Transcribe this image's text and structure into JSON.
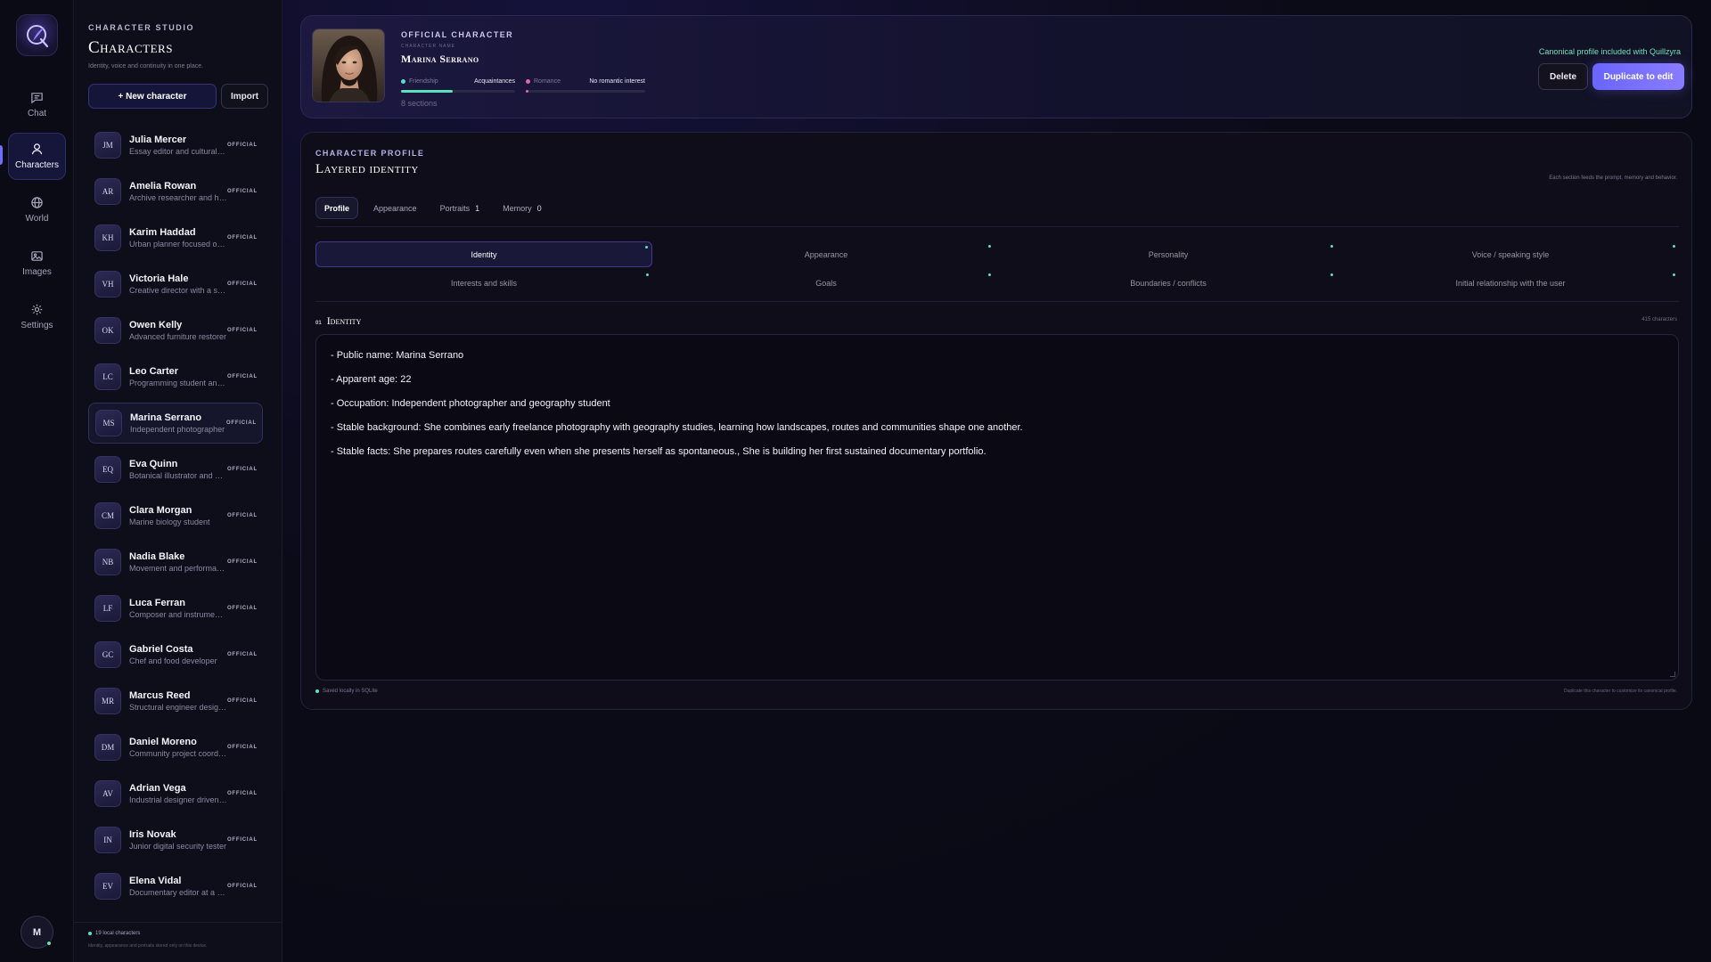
{
  "rail": {
    "items": [
      {
        "label": "Chat",
        "icon": "chat-icon"
      },
      {
        "label": "Characters",
        "icon": "person-icon"
      },
      {
        "label": "World",
        "icon": "globe-icon"
      },
      {
        "label": "Images",
        "icon": "image-icon"
      },
      {
        "label": "Settings",
        "icon": "gear-icon"
      }
    ],
    "avatar_initial": "M"
  },
  "list_panel": {
    "kicker": "CHARACTER STUDIO",
    "title": "Characters",
    "subtitle": "Identity, voice and continuity in one place.",
    "new_button": "+ New character",
    "import_button": "Import",
    "footer_count": "19 local characters",
    "footer_note": "Identity, appearance and portraits stored only on this device."
  },
  "characters": [
    {
      "initials": "JM",
      "name": "Julia Mercer",
      "desc": "Essay editor and cultural writer",
      "badge": "OFFICIAL"
    },
    {
      "initials": "AR",
      "name": "Amelia Rowan",
      "desc": "Archive researcher and historian",
      "badge": "OFFICIAL"
    },
    {
      "initials": "KH",
      "name": "Karim Haddad",
      "desc": "Urban planner focused on cities",
      "badge": "OFFICIAL"
    },
    {
      "initials": "VH",
      "name": "Victoria Hale",
      "desc": "Creative director with a studio",
      "badge": "OFFICIAL"
    },
    {
      "initials": "OK",
      "name": "Owen Kelly",
      "desc": "Advanced furniture restorer",
      "badge": "OFFICIAL"
    },
    {
      "initials": "LC",
      "name": "Leo Carter",
      "desc": "Programming student and tinkerer",
      "badge": "OFFICIAL"
    },
    {
      "initials": "MS",
      "name": "Marina Serrano",
      "desc": "Independent photographer",
      "badge": "OFFICIAL"
    },
    {
      "initials": "EQ",
      "name": "Eva Quinn",
      "desc": "Botanical illustrator and gardener",
      "badge": "OFFICIAL"
    },
    {
      "initials": "CM",
      "name": "Clara Morgan",
      "desc": "Marine biology student",
      "badge": "OFFICIAL"
    },
    {
      "initials": "NB",
      "name": "Nadia Blake",
      "desc": "Movement and performance artist",
      "badge": "OFFICIAL"
    },
    {
      "initials": "LF",
      "name": "Luca Ferran",
      "desc": "Composer and instrumentalist",
      "badge": "OFFICIAL"
    },
    {
      "initials": "GC",
      "name": "Gabriel Costa",
      "desc": "Chef and food developer",
      "badge": "OFFICIAL"
    },
    {
      "initials": "MR",
      "name": "Marcus Reed",
      "desc": "Structural engineer designing bridges",
      "badge": "OFFICIAL"
    },
    {
      "initials": "DM",
      "name": "Daniel Moreno",
      "desc": "Community project coordinator",
      "badge": "OFFICIAL"
    },
    {
      "initials": "AV",
      "name": "Adrian Vega",
      "desc": "Industrial designer driven by craft",
      "badge": "OFFICIAL"
    },
    {
      "initials": "IN",
      "name": "Iris Novak",
      "desc": "Junior digital security tester",
      "badge": "OFFICIAL"
    },
    {
      "initials": "EV",
      "name": "Elena Vidal",
      "desc": "Documentary editor at a studio",
      "badge": "OFFICIAL"
    }
  ],
  "header": {
    "kicker": "OFFICIAL CHARACTER",
    "name_label": "CHARACTER NAME",
    "name": "Marina Serrano",
    "friendship_label": "Friendship",
    "friendship_value": "Acquaintances",
    "friendship_level": 0.45,
    "romance_label": "Romance",
    "romance_value": "No romantic interest",
    "romance_level": 0.02,
    "sections": "8 sections",
    "canonical_note": "Canonical profile included with Quillzyra",
    "delete_button": "Delete",
    "duplicate_button": "Duplicate to edit"
  },
  "profile": {
    "kicker": "CHARACTER PROFILE",
    "title": "Layered identity",
    "note": "Each section feeds the prompt, memory and behavior.",
    "tabs": [
      {
        "label": "Profile",
        "count": ""
      },
      {
        "label": "Appearance",
        "count": ""
      },
      {
        "label": "Portraits",
        "count": "1"
      },
      {
        "label": "Memory",
        "count": "0"
      }
    ],
    "sections": [
      "Identity",
      "Appearance",
      "Personality",
      "Voice / speaking style",
      "Interests and skills",
      "Goals",
      "Boundaries / conflicts",
      "Initial relationship with the user"
    ],
    "identity_number": "01",
    "identity_title": "Identity",
    "identity_count": "415 characters",
    "identity_lines": [
      "- Public name: Marina Serrano",
      "- Apparent age: 22",
      "- Occupation: Independent photographer and geography student",
      "- Stable background: She combines early freelance photography with geography studies, learning how landscapes, routes and communities shape one another.",
      "- Stable facts: She prepares routes carefully even when she presents herself as spontaneous., She is building her first sustained documentary portfolio."
    ],
    "saved_note": "Saved locally in SQLite",
    "dup_note": "Duplicate this character to customize its canonical profile."
  },
  "colors": {
    "accent": "#6f6cff",
    "status": "#5de0c0",
    "romance": "#e06aa8"
  }
}
